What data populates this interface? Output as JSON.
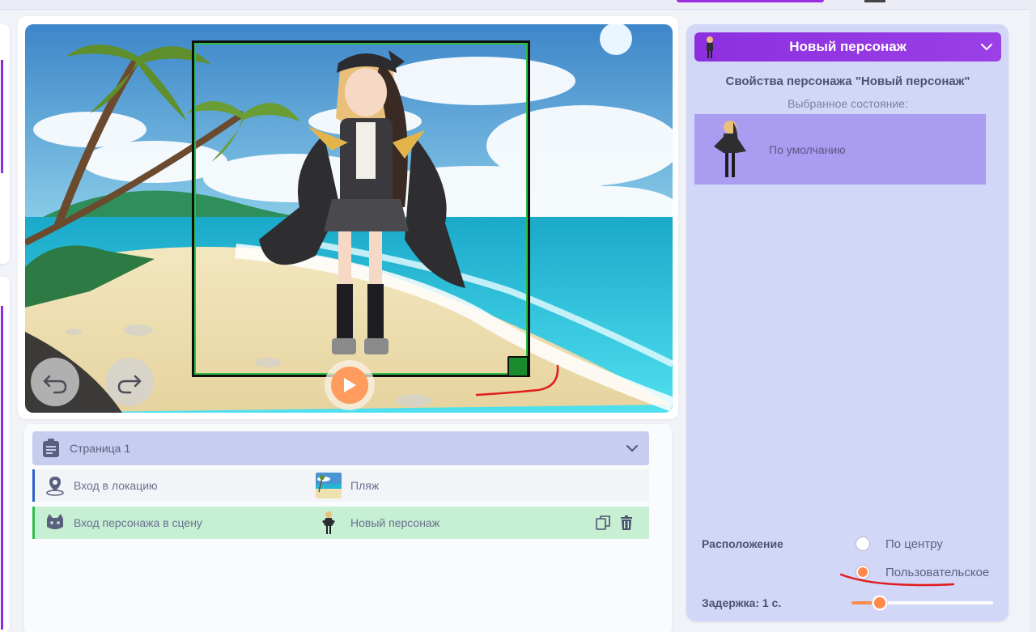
{
  "editor": {
    "controls": {
      "undo_icon": "undo-arrow-icon",
      "redo_icon": "redo-arrow-icon",
      "play_icon": "play-icon"
    }
  },
  "page": {
    "title": "Страница 1",
    "rows": [
      {
        "label": "Вход в локацию",
        "value": "Пляж",
        "icon": "location-pin-icon"
      },
      {
        "label": "Вход персонажа в сцену",
        "value": "Новый персонаж",
        "icon": "cat-mask-icon"
      }
    ]
  },
  "character_panel": {
    "header": "Новый персонаж",
    "properties_title": "Свойства персонажа \"Новый персонаж\"",
    "selected_state_label": "Выбранное состояние:",
    "state_name": "По умолчанию",
    "position_label": "Расположение",
    "position_options": [
      "По центру",
      "Пользовательское"
    ],
    "position_selected": "Пользовательское",
    "delay_label": "Задержка: 1 с.",
    "delay_fraction": 0.2
  },
  "colors": {
    "accent_purple": "#8f2bd9",
    "accent_orange": "#ff8a4c",
    "selection_green": "#2fbf47",
    "annotation_red": "#e01d1d"
  }
}
